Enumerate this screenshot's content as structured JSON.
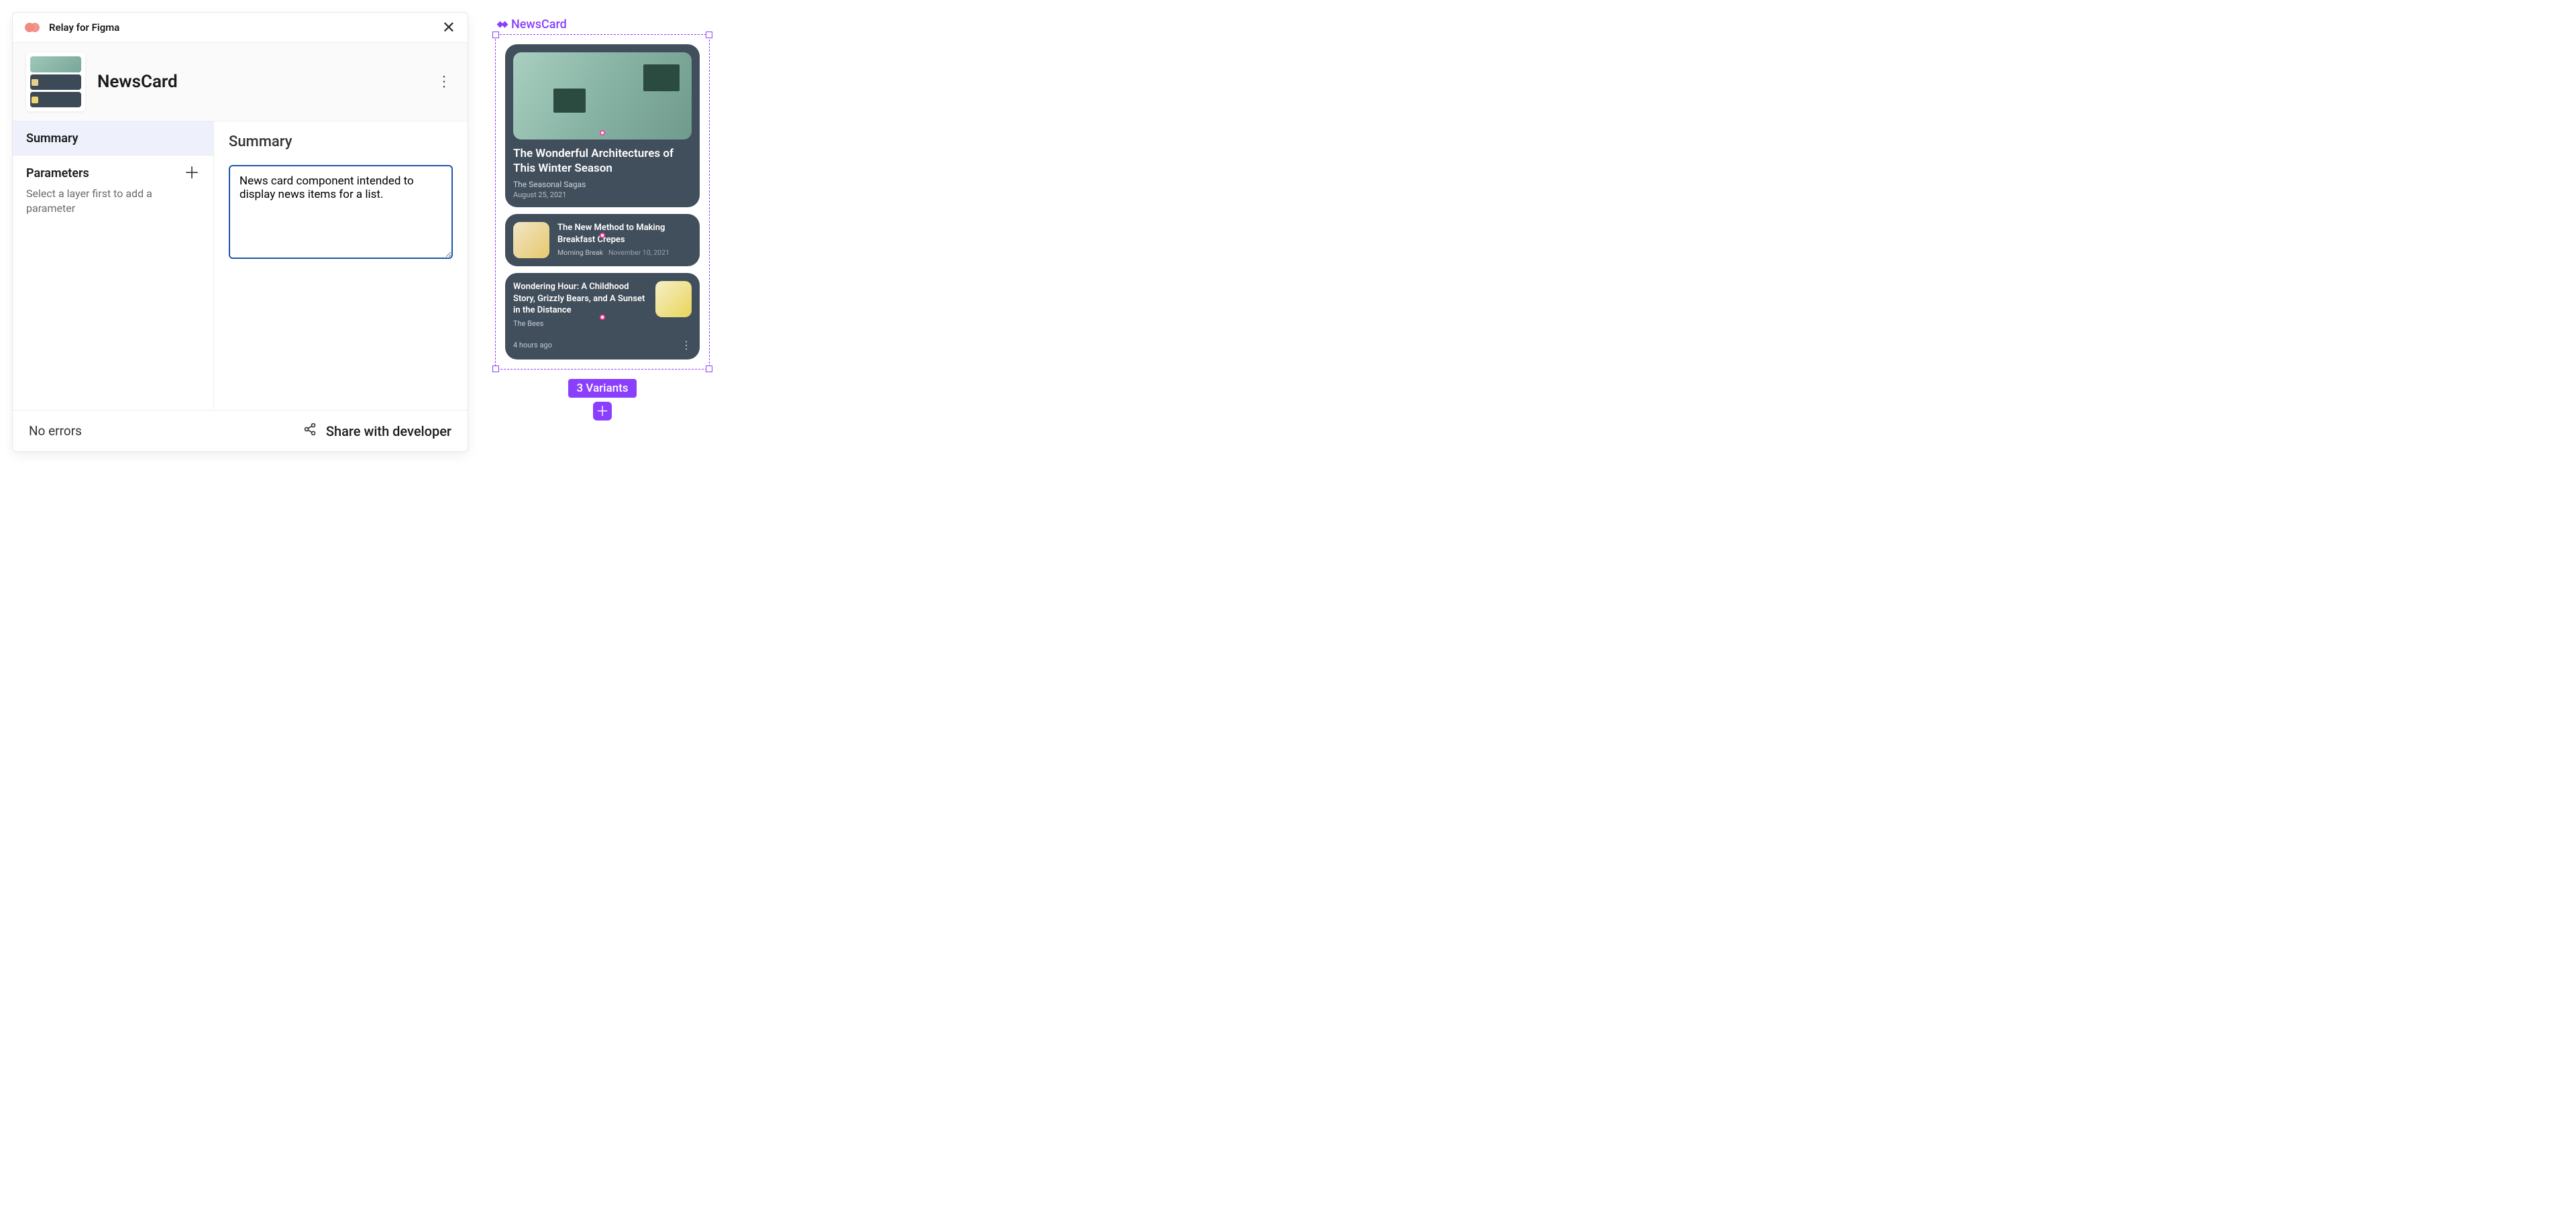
{
  "plugin": {
    "title": "Relay for Figma",
    "close_label": "✕"
  },
  "header": {
    "component_name": "NewsCard"
  },
  "sidebar": {
    "summary_tab": "Summary",
    "parameters_title": "Parameters",
    "hint": "Select a layer first to add a parameter"
  },
  "main": {
    "heading": "Summary",
    "summary_text": "News card component intended to display news items for a list."
  },
  "footer": {
    "status": "No errors",
    "share_label": "Share with developer"
  },
  "canvas": {
    "frame_label": "NewsCard",
    "variants_badge": "3 Variants",
    "cards": {
      "hero": {
        "title": "The Wonderful Architectures of This Winter Season",
        "source": "The Seasonal Sagas",
        "date": "August 25, 2021"
      },
      "row1": {
        "title": "The New Method to Making Breakfast Crepes",
        "source": "Morning Break",
        "date": "November 10, 2021"
      },
      "row2": {
        "title": "Wondering Hour: A Childhood Story, Grizzly Bears, and A Sunset in the Distance",
        "source": "The Bees",
        "age": "4 hours ago"
      }
    }
  }
}
